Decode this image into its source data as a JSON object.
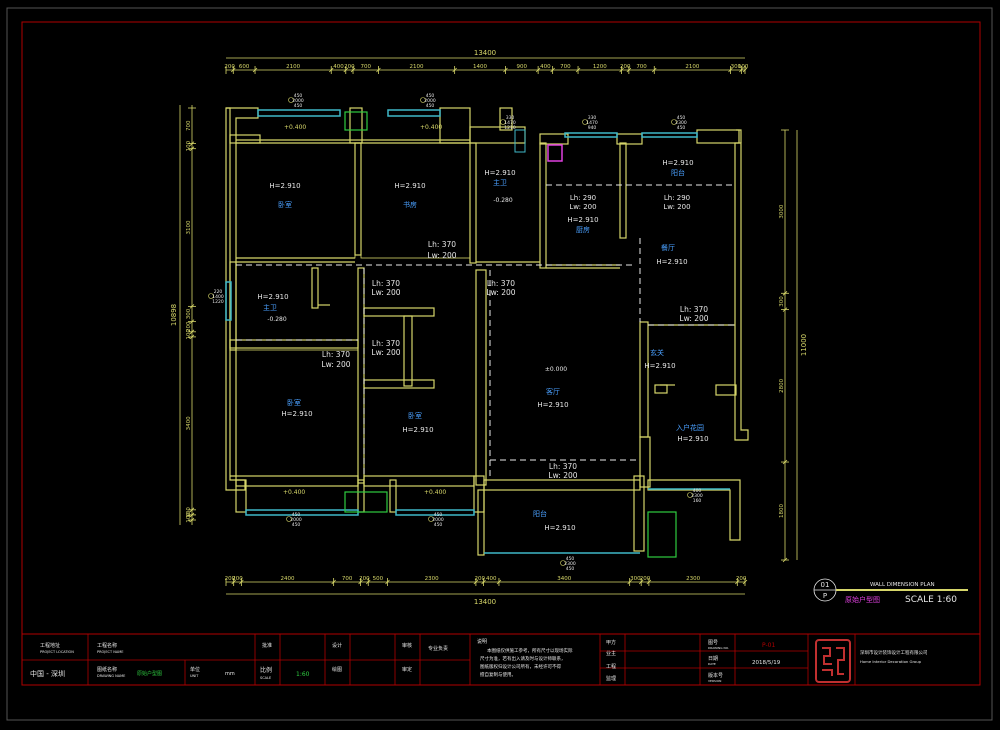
{
  "colors": {
    "background": "#000000",
    "frame": "#b00000",
    "wall": "#d6d66a",
    "dimension": "#d8d86a",
    "room_label": "#4aa0ff",
    "measure": "#e6e6e6",
    "window": "#3fb8c8",
    "door": "#e8e8e8",
    "pink": "#e040e0",
    "green": "#2ecc40",
    "title_block_text": "#e6e6e6"
  },
  "dims": {
    "top_total": "13400",
    "bottom_total": "13400",
    "top_segments": [
      "200",
      "600",
      "2100",
      "400",
      "200",
      "700",
      "2100",
      "1400",
      "900",
      "400",
      "700",
      "1200",
      "200",
      "700",
      "2100",
      "300",
      "100"
    ],
    "bottom_segments": [
      "200",
      "200",
      "2400",
      "700",
      "200",
      "500",
      "2300",
      "200",
      "400",
      "3400",
      "300",
      "200",
      "2300",
      "200"
    ],
    "left_total": "10898",
    "left_segments": [
      "700",
      "100",
      "3100",
      "300",
      "200",
      "100",
      "3400",
      "100",
      "100"
    ],
    "right_total": "11000",
    "right_segments": [
      "3000",
      "300",
      "2800",
      "1800"
    ]
  },
  "rooms": [
    {
      "name": "卧室",
      "h": "H=2.910"
    },
    {
      "name": "书房",
      "h": "H=2.910"
    },
    {
      "name": "主卫",
      "h": "H=2.910",
      "floor": "-0.280"
    },
    {
      "name": "厨房",
      "h": "H=2.910",
      "lh": "Lh: 290",
      "lw": "Lw: 200"
    },
    {
      "name": "阳台",
      "h": "H=2.910",
      "lh": "Lh: 290",
      "lw": "Lw: 200"
    },
    {
      "name": "餐厅",
      "h": "H=2.910"
    },
    {
      "name": "主卫",
      "h": "H=2.910",
      "floor": "-0.280"
    },
    {
      "name": "卧室",
      "h": "H=2.910"
    },
    {
      "name": "卧室",
      "h": "H=2.910"
    },
    {
      "name": "客厅",
      "h": "H=2.910",
      "floor": "±0.000"
    },
    {
      "name": "玄关",
      "h": "H=2.910"
    },
    {
      "name": "入户花园",
      "h": "H=2.910"
    },
    {
      "name": "阳台",
      "h": "H=2.910"
    }
  ],
  "openings": [
    {
      "lh": "Lh: 370",
      "lw": "Lw: 200"
    },
    {
      "lh": "Lh: 370",
      "lw": "Lw: 200"
    },
    {
      "lh": "Lh: 370",
      "lw": "Lw: 200"
    },
    {
      "lh": "Lh: 370",
      "lw": "Lw: 200"
    },
    {
      "lh": "Lh: 370",
      "lw": "Lw: 200"
    },
    {
      "lh": "Lh: 370",
      "lw": "Lw: 200"
    },
    {
      "lh": "Lh: 370",
      "lw": "Lw: 200"
    }
  ],
  "levels": [
    "+0.400",
    "+0.400",
    "+0.400",
    "+0.400",
    "-0.280",
    "-0.280"
  ],
  "window_tags": [
    {
      "a": "450",
      "b": "2000",
      "c": "450"
    },
    {
      "a": "450",
      "b": "2000",
      "c": "450"
    },
    {
      "a": "330",
      "b": "1470",
      "c": "1210"
    },
    {
      "a": "330",
      "b": "1470",
      "c": "940"
    },
    {
      "a": "450",
      "b": "2300",
      "c": "450"
    },
    {
      "a": "450",
      "b": "2000",
      "c": "450"
    },
    {
      "a": "450",
      "b": "2000",
      "c": "450"
    },
    {
      "a": "220",
      "b": "1400",
      "c": "1220"
    },
    {
      "a": "400",
      "b": "2300",
      "c": "160"
    },
    {
      "a": "450",
      "b": "2300",
      "c": "450"
    }
  ],
  "plan_label": {
    "code_top": "01",
    "code_bottom": "P",
    "title_en": "WALL DIMENSION PLAN",
    "title_cn": "原始户型图",
    "scale": "SCALE 1:60"
  },
  "title_block": {
    "project_location_label": "工程地址",
    "project_location_en": "PROJECT LOCATION",
    "project_location": "中国 - 深圳",
    "project_name_label": "工程名称",
    "project_name_en": "PROJECT NAME",
    "drawing_name_label": "图纸名称",
    "drawing_name_en": "DRAWING NAME",
    "drawing_name": "原始户型图",
    "unit_label": "单位",
    "unit_en": "UNIT",
    "unit_value": "mm",
    "scale_label": "比例",
    "scale_en": "SCALE",
    "scale_value": "1:60",
    "design_label": "设计",
    "drawing_label": "绘图",
    "check_label": "审核",
    "review_label": "审定",
    "approve_label": "批准",
    "approve_value": "专业负责",
    "notes_label": "说明",
    "notes": [
      "本图纸仅供施工参考，所有尺寸以现场实际",
      "尺寸为准，若有出入请及时与设计师联系，",
      "图纸版权归设计公司所有，未经许可不得",
      "擅自复制与使用。"
    ],
    "sign1": "甲方",
    "sign2": "业主",
    "sign3": "工程",
    "sign4": "监理",
    "drawing_no_label": "图号",
    "drawing_no_en": "DRAWING NO.",
    "drawing_no": "P-01",
    "date_label": "日期",
    "date_en": "DATE",
    "date": "2018/5/19",
    "version_label": "版本号",
    "version_en": "VERSION",
    "company_cn": "深圳市设计装饰设计工程有限公司",
    "company_en": "Home Interior Decoration Group"
  }
}
